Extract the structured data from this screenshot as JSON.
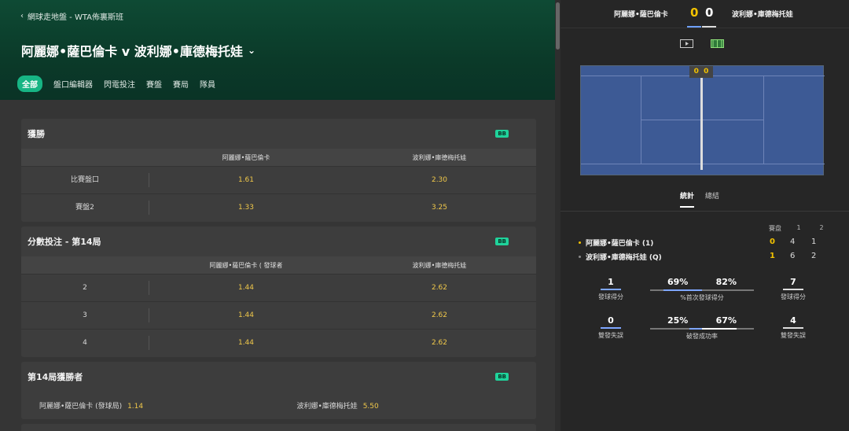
{
  "breadcrumb": {
    "chevron": "‹",
    "text": "網球走地盤 - WTA佈裏斯班"
  },
  "match": {
    "title": "阿麗娜•薩巴倫卡 v 波利娜•庫德梅托娃",
    "chevron": "⌄"
  },
  "tabs": [
    "全部",
    "盤口編輯器",
    "閃電投注",
    "賽盤",
    "賽局",
    "隊員"
  ],
  "cards": {
    "win": {
      "title": "獲勝",
      "badge": "BB",
      "headers": [
        "",
        "阿麗娜•薩巴倫卡",
        "波利娜•庫德梅托娃"
      ],
      "rows": [
        {
          "label": "比賽盤口",
          "a": "1.61",
          "b": "2.30"
        },
        {
          "label": "賽盤2",
          "a": "1.33",
          "b": "3.25"
        }
      ]
    },
    "score": {
      "title": "分數投注 - 第14局",
      "badge": "BB",
      "headers": [
        "",
        "阿麗娜•薩巴倫卡 ( 發球者",
        "波利娜•庫德梅托娃"
      ],
      "rows": [
        {
          "label": "2",
          "a": "1.44",
          "b": "2.62"
        },
        {
          "label": "3",
          "a": "1.44",
          "b": "2.62"
        },
        {
          "label": "4",
          "a": "1.44",
          "b": "2.62"
        }
      ]
    },
    "game": {
      "title": "第14局獲勝者",
      "badge": "BB",
      "a_label": "阿麗娜•薩巴倫卡 (發球局)",
      "a_odd": "1.14",
      "b_label": "波利娜•庫德梅托娃",
      "b_odd": "5.50"
    }
  },
  "scoreboard": {
    "player_a": "阿麗娜•薩巴倫卡",
    "score_a": "0",
    "player_b": "波利娜•庫德梅托娃",
    "score_b": "0",
    "court_score_a": "0",
    "court_score_b": "0"
  },
  "stat_tabs": [
    "統計",
    "總結"
  ],
  "sets": {
    "header": [
      "賽盘",
      "1",
      "2"
    ],
    "players": [
      {
        "name": "阿麗娜•薩巴倫卡 (1)",
        "current": "0",
        "s1": "4",
        "s2": "1",
        "dot": "#f2c200"
      },
      {
        "name": "波利娜•庫德梅托娃 (Q)",
        "current": "1",
        "s1": "6",
        "s2": "2",
        "dot": "#888"
      }
    ]
  },
  "stats": {
    "aces_a": "1",
    "aces_b": "7",
    "aces_label": "發球得分",
    "first_serve_a": "69%",
    "first_serve_b": "82%",
    "first_serve_label": "%首次發球得分",
    "df_a": "0",
    "df_b": "4",
    "df_label": "雙發失誤",
    "bp_a": "25%",
    "bp_b": "67%",
    "bp_label": "破發成功率"
  },
  "colors": {
    "accent": "#17b584",
    "odds": "#f0c84a",
    "score": "#f2c200",
    "bar_a": "#7ea6ff"
  }
}
